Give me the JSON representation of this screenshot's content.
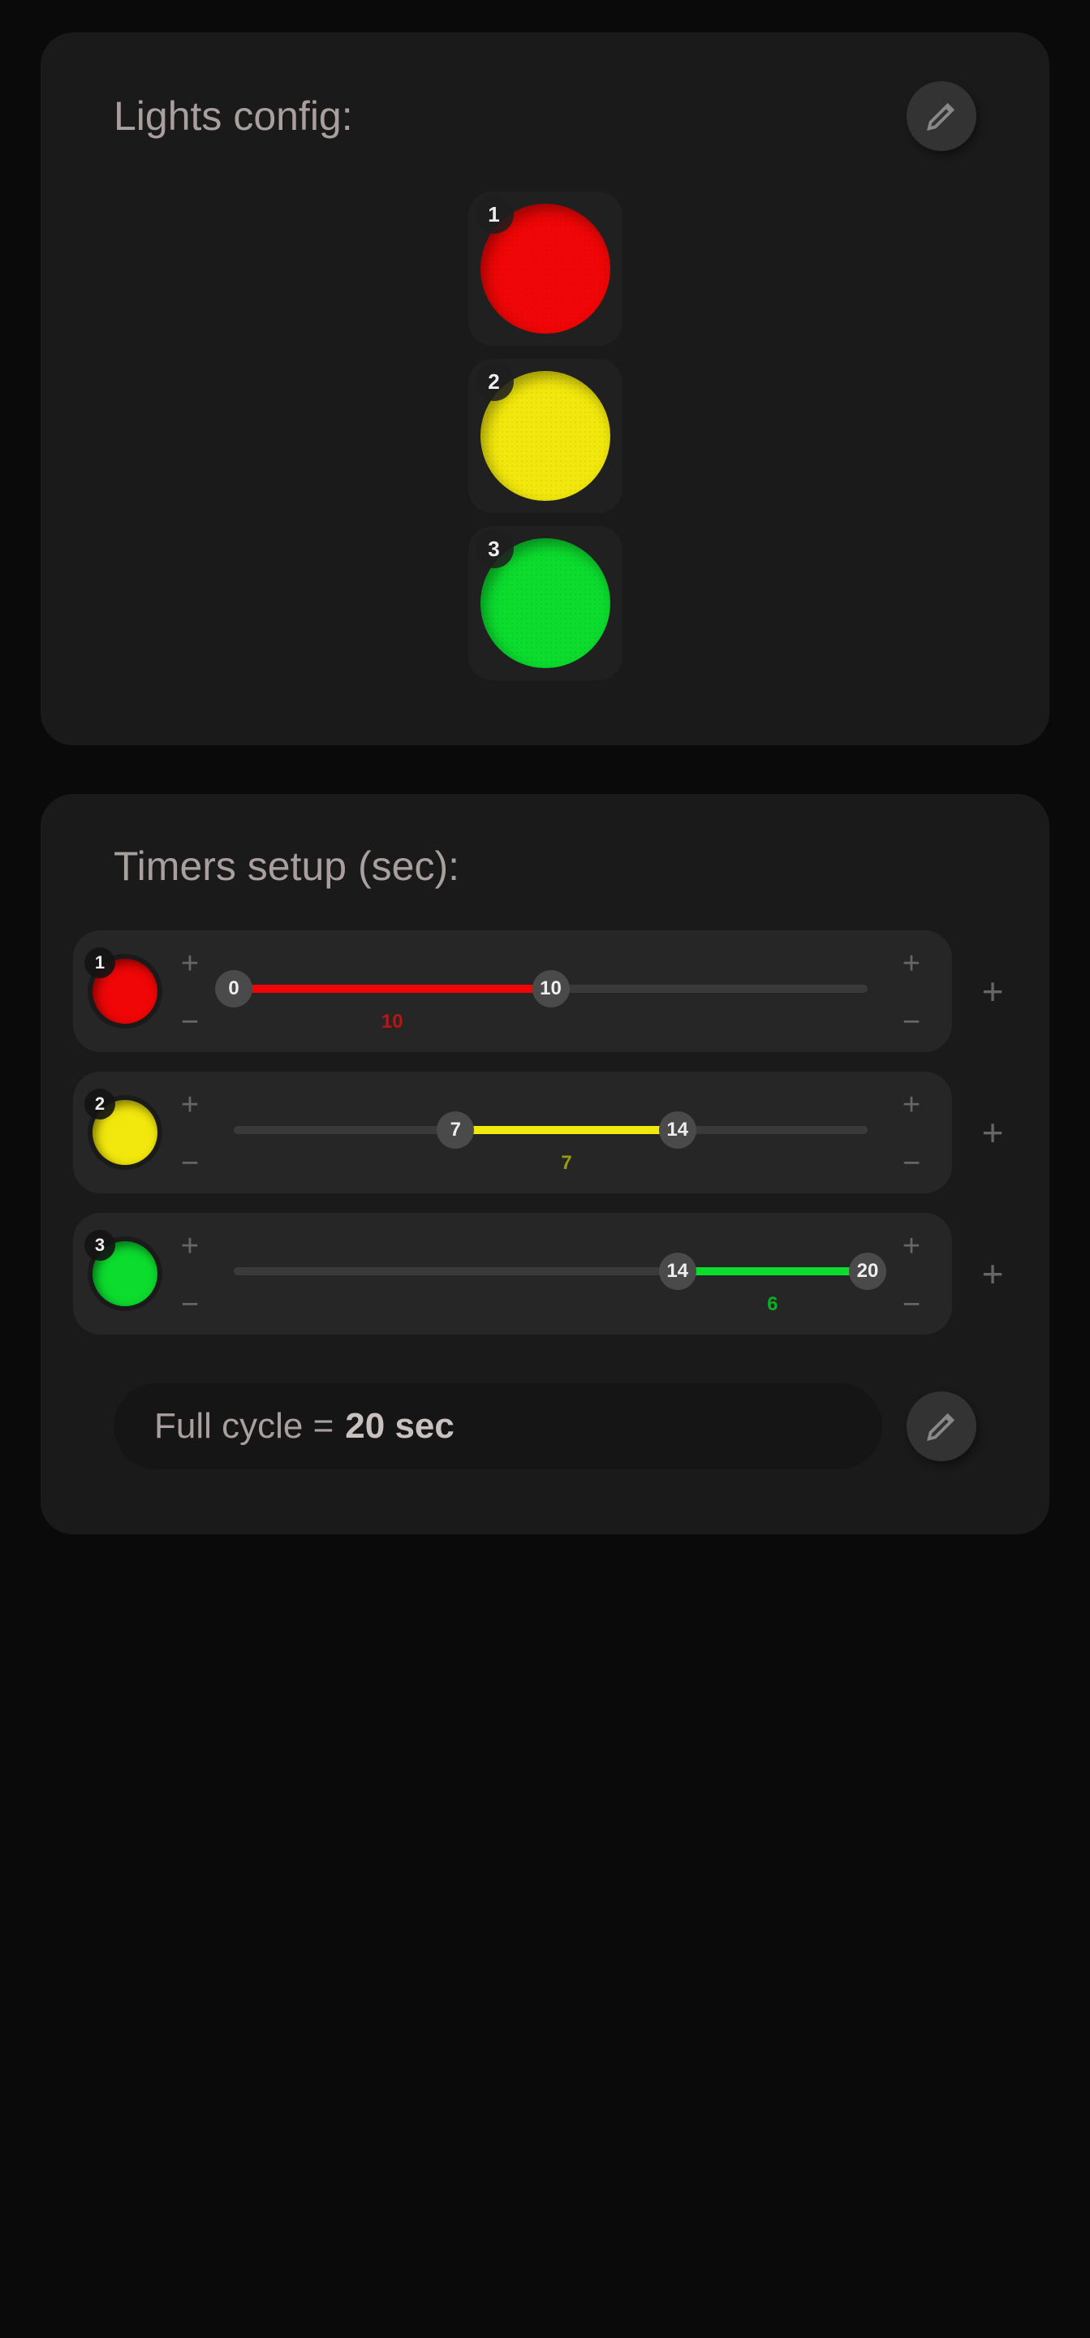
{
  "lights_config": {
    "title": "Lights config:",
    "lights": [
      {
        "id": "1",
        "color": "#f00606",
        "name": "red"
      },
      {
        "id": "2",
        "color": "#f2e80d",
        "name": "yellow"
      },
      {
        "id": "3",
        "color": "#0cdc2e",
        "name": "green"
      }
    ]
  },
  "timers": {
    "title": "Timers setup (sec):",
    "max": 20,
    "rows": [
      {
        "id": "1",
        "color": "#f00606",
        "start": 0,
        "end": 10,
        "span": 10,
        "labelColor": "#b51616"
      },
      {
        "id": "2",
        "color": "#f2e80d",
        "start": 7,
        "end": 14,
        "span": 7,
        "labelColor": "#9a9a12"
      },
      {
        "id": "3",
        "color": "#0cdc2e",
        "start": 14,
        "end": 20,
        "span": 6,
        "labelColor": "#0cae26"
      }
    ],
    "symbols": {
      "plus": "+",
      "minus": "−",
      "add": "+"
    },
    "full_cycle": {
      "prefix": "Full cycle = ",
      "value": "20 sec"
    }
  }
}
